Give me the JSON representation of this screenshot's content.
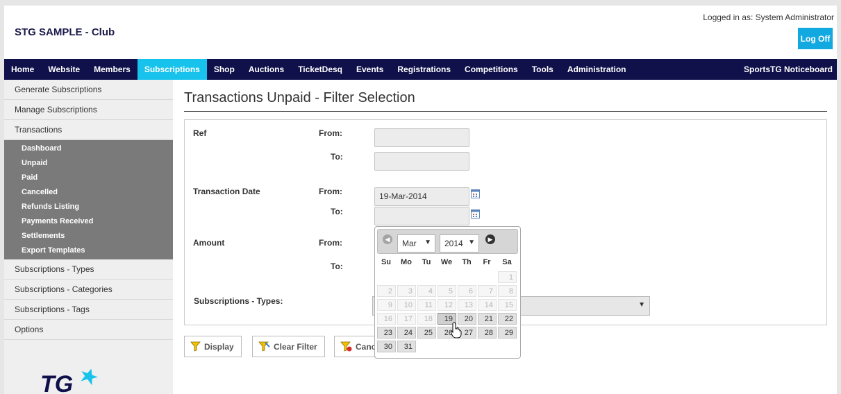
{
  "header": {
    "club_title": "STG SAMPLE - Club",
    "logged_in": "Logged in as: System Administrator",
    "logoff_label": "Log Off"
  },
  "nav": {
    "items": [
      "Home",
      "Website",
      "Members",
      "Subscriptions",
      "Shop",
      "Auctions",
      "TicketDesq",
      "Events",
      "Registrations",
      "Competitions",
      "Tools",
      "Administration"
    ],
    "active": "Subscriptions",
    "right_label": "SportsTG Noticeboard",
    "active_color": "#17c3ec",
    "bar_color": "#10104a"
  },
  "sidebar": {
    "items_top": [
      "Generate Subscriptions",
      "Manage Subscriptions",
      "Transactions"
    ],
    "sub_items": [
      "Dashboard",
      "Unpaid",
      "Paid",
      "Cancelled",
      "Refunds Listing",
      "Payments Received",
      "Settlements",
      "Export Templates"
    ],
    "items_bottom": [
      "Subscriptions - Types",
      "Subscriptions - Categories",
      "Subscriptions - Tags",
      "Options"
    ],
    "logo_text": "TG"
  },
  "main": {
    "title": "Transactions Unpaid - Filter Selection",
    "ref_label": "Ref",
    "ref_from_label": "From:",
    "ref_to_label": "To:",
    "date_label": "Transaction Date",
    "date_from_label": "From:",
    "date_from_value": "19-Mar-2014",
    "date_to_label": "To:",
    "amount_label": "Amount",
    "amount_from_label": "From:",
    "amount_to_label": "To:",
    "types_label": "Subscriptions - Types:",
    "display_button": "Display",
    "clear_button": "Clear Filter",
    "cancel_button": "Cancel"
  },
  "datepicker": {
    "month": "Mar",
    "year": "2014",
    "weekdays": [
      "Su",
      "Mo",
      "Tu",
      "We",
      "Th",
      "Fr",
      "Sa"
    ],
    "rows": [
      [
        "",
        "",
        "",
        "",
        "",
        "",
        "1"
      ],
      [
        "2",
        "3",
        "4",
        "5",
        "6",
        "7",
        "8"
      ],
      [
        "9",
        "10",
        "11",
        "12",
        "13",
        "14",
        "15"
      ],
      [
        "16",
        "17",
        "18",
        "19",
        "20",
        "21",
        "22"
      ],
      [
        "23",
        "24",
        "25",
        "26",
        "27",
        "28",
        "29"
      ],
      [
        "30",
        "31",
        "",
        "",
        "",
        "",
        ""
      ]
    ],
    "selected_day": "19",
    "disabled_before": 19
  }
}
